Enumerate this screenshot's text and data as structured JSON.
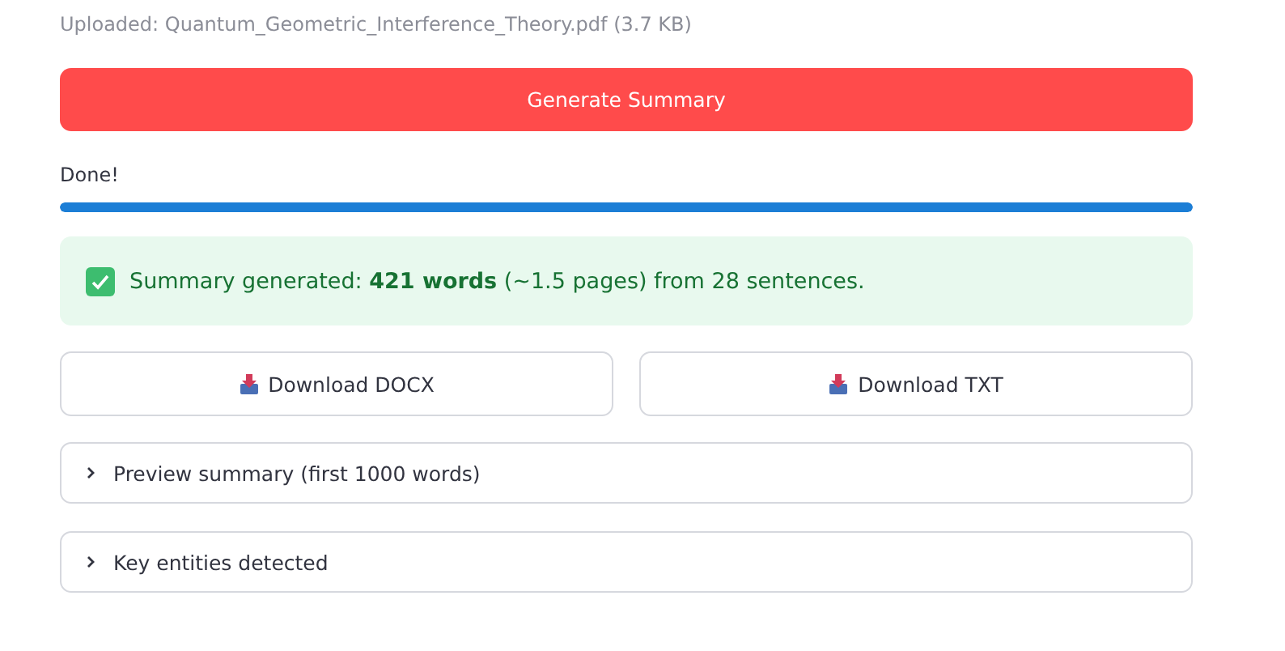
{
  "upload_caption": "Uploaded: Quantum_Geometric_Interference_Theory.pdf (3.7 KB)",
  "generate_button": "Generate Summary",
  "progress": {
    "label": "Done!",
    "level": 1
  },
  "success": {
    "message": "Summary generated: **421 words** (~1.5 pages) from 28 sentences."
  },
  "download_buttons": [
    "Download DOCX",
    "Download TXT"
  ],
  "expanders": [
    {
      "label": "Preview summary (first 1000 words)",
      "expanded": false
    },
    {
      "label": "Key entities detected",
      "expanded": false
    }
  ]
}
